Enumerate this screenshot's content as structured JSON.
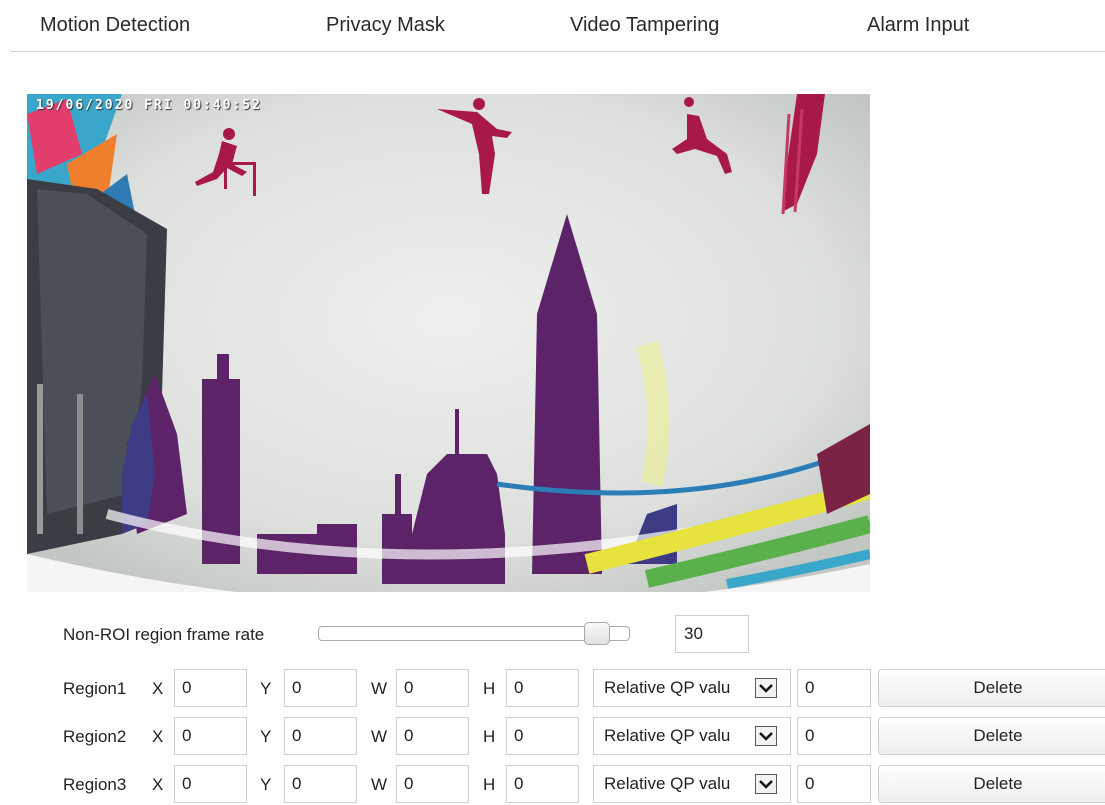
{
  "tabs": [
    {
      "label": "Motion Detection"
    },
    {
      "label": "Privacy Mask"
    },
    {
      "label": "Video Tampering"
    },
    {
      "label": "Alarm Input"
    }
  ],
  "video": {
    "osd_timestamp": "19/06/2020 FRI 00:40:52"
  },
  "frame_rate": {
    "label": "Non-ROI region frame rate",
    "value": "30",
    "slider_fraction": 0.93
  },
  "regions": [
    {
      "label": "Region1",
      "x_label": "X",
      "x": "0",
      "y_label": "Y",
      "y": "0",
      "w_label": "W",
      "w": "0",
      "h_label": "H",
      "h": "0",
      "qp_mode": "Relative QP valu",
      "qp_value": "0",
      "delete_label": "Delete"
    },
    {
      "label": "Region2",
      "x_label": "X",
      "x": "0",
      "y_label": "Y",
      "y": "0",
      "w_label": "W",
      "w": "0",
      "h_label": "H",
      "h": "0",
      "qp_mode": "Relative QP valu",
      "qp_value": "0",
      "delete_label": "Delete"
    },
    {
      "label": "Region3",
      "x_label": "X",
      "x": "0",
      "y_label": "Y",
      "y": "0",
      "w_label": "W",
      "w": "0",
      "h_label": "H",
      "h": "0",
      "qp_mode": "Relative QP valu",
      "qp_value": "0",
      "delete_label": "Delete"
    }
  ]
}
